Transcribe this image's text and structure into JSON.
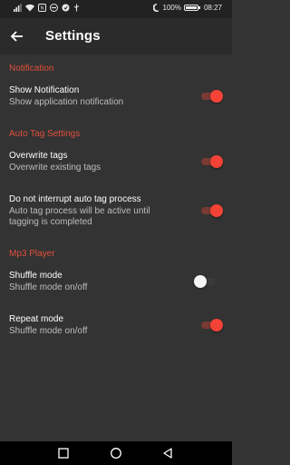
{
  "status_bar": {
    "battery": "100%",
    "time": "08:27",
    "icons": [
      "signal-icon",
      "wifi-icon",
      "nfc-icon",
      "dnd-icon",
      "vpn-icon",
      "usb-icon",
      "moon-icon",
      "battery-icon"
    ]
  },
  "app_bar": {
    "title": "Settings",
    "back_icon": "arrow-back-icon"
  },
  "colors": {
    "accent": "#e0503a",
    "background": "#333333",
    "toggle_on": "#f44336"
  },
  "sections": {
    "notification": {
      "header": "Notification",
      "show_notification": {
        "title": "Show Notification",
        "subtitle": "Show application notification",
        "enabled": true
      }
    },
    "auto_tag": {
      "header": "Auto Tag Settings",
      "overwrite_tags": {
        "title": "Overwrite tags",
        "subtitle": "Overwrite existing tags",
        "enabled": true
      },
      "do_not_interrupt": {
        "title": "Do not interrupt auto tag process",
        "subtitle": "Auto tag process will be active until tagging is completed",
        "enabled": true
      }
    },
    "mp3_player": {
      "header": "Mp3 Player",
      "shuffle_mode": {
        "title": "Shuffle mode",
        "subtitle": "Shuffle mode on/off",
        "enabled": false
      },
      "repeat_mode": {
        "title": "Repeat mode",
        "subtitle": "Shuffle mode on/off",
        "enabled": true
      }
    }
  },
  "nav_bar": {
    "icons": [
      "recents-square-icon",
      "home-circle-icon",
      "back-triangle-icon"
    ]
  }
}
